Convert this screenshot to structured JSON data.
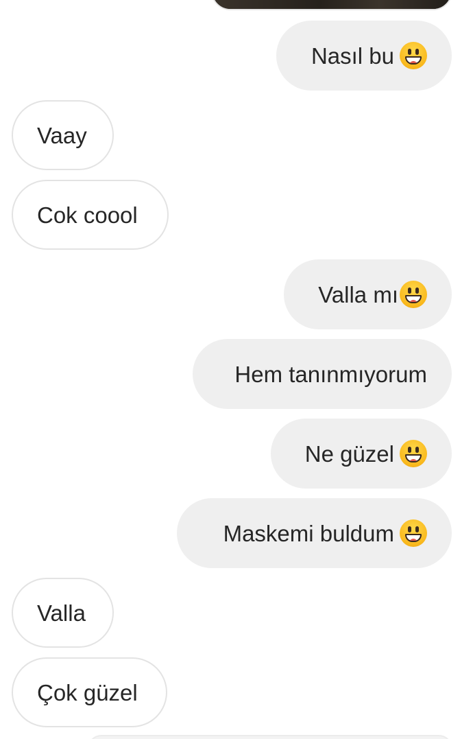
{
  "conversation": {
    "messages": [
      {
        "direction": "sent",
        "text": "Nasıl bu",
        "emoji": "grinning-face-icon"
      },
      {
        "direction": "received",
        "text": "Vaay"
      },
      {
        "direction": "received",
        "text": "Cok coool"
      },
      {
        "direction": "sent",
        "text": "Valla mı",
        "emoji": "grinning-face-icon"
      },
      {
        "direction": "sent",
        "text": "Hem tanınmıyorum"
      },
      {
        "direction": "sent",
        "text": "Ne güzel",
        "emoji": "grinning-face-icon"
      },
      {
        "direction": "sent",
        "text": "Maskemi buldum",
        "emoji": "grinning-face-icon"
      },
      {
        "direction": "received",
        "text": "Valla"
      },
      {
        "direction": "received",
        "text": "Çok güzel"
      }
    ]
  },
  "colors": {
    "sent_bubble": "#efefef",
    "received_bubble_border": "#e3e3e3",
    "text": "#262626",
    "background": "#ffffff"
  }
}
